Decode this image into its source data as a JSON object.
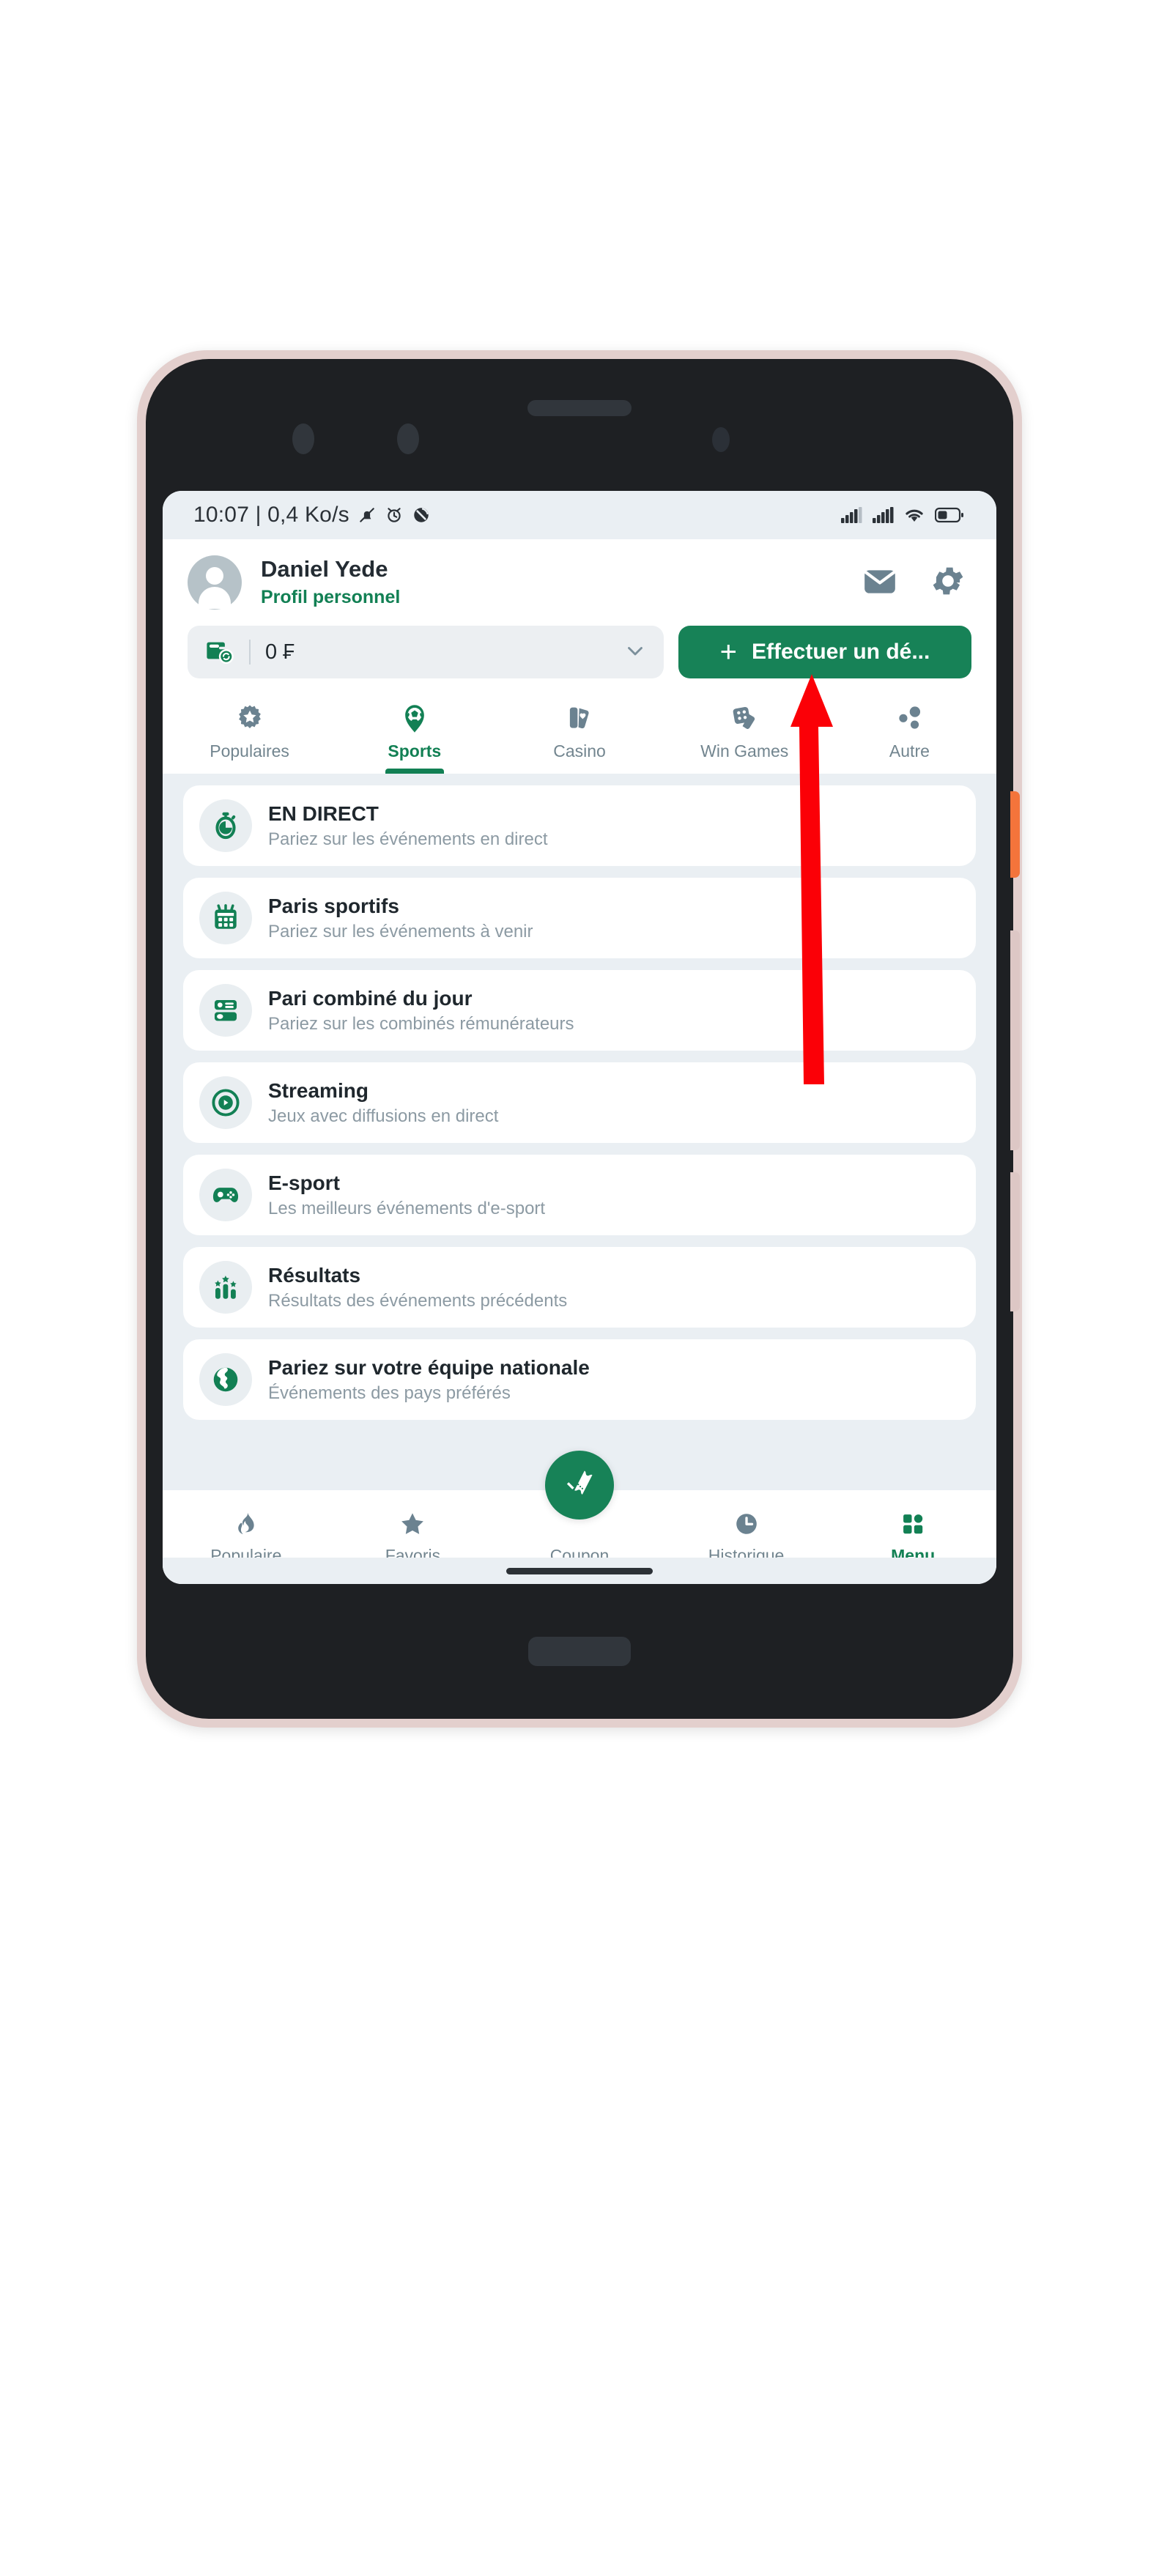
{
  "status_bar": {
    "clock_text": "10:07 | 0,4 Ko/s",
    "left_icons": [
      "mute-bell-icon",
      "alarm-icon",
      "dnd-icon"
    ],
    "right_icons": [
      "signal-1-icon",
      "signal-2-icon",
      "wifi-icon",
      "battery-icon"
    ],
    "battery_level_pct": 40
  },
  "header": {
    "profile_name": "Daniel Yede",
    "profile_subtitle": "Profil personnel",
    "avatar_icon": "person-avatar-icon",
    "mail_icon": "mail-icon",
    "settings_icon": "gear-icon"
  },
  "balance": {
    "wallet_icon": "wallet-refresh-icon",
    "value": "0 ₣",
    "chevron_icon": "chevron-down-icon",
    "deposit_label": "Effectuer un dé...",
    "deposit_plus": "+"
  },
  "category_tabs": [
    {
      "label": "Populaires",
      "icon": "star-burst-icon",
      "active": false
    },
    {
      "label": "Sports",
      "icon": "football-icon",
      "active": true
    },
    {
      "label": "Casino",
      "icon": "playing-cards-icon",
      "active": false
    },
    {
      "label": "Win Games",
      "icon": "dice-cards-icon",
      "active": false
    },
    {
      "label": "Autre",
      "icon": "dots-cluster-icon",
      "active": false
    }
  ],
  "menu_items": [
    {
      "title": "EN DIRECT",
      "subtitle": "Pariez sur les événements en direct",
      "icon": "stopwatch-icon"
    },
    {
      "title": "Paris sportifs",
      "subtitle": "Pariez sur les événements à venir",
      "icon": "calendar-icon"
    },
    {
      "title": "Pari combiné du jour",
      "subtitle": "Pariez sur les combinés rémunérateurs",
      "icon": "slip-list-icon"
    },
    {
      "title": "Streaming",
      "subtitle": "Jeux avec diffusions en direct",
      "icon": "play-circle-icon"
    },
    {
      "title": "E-sport",
      "subtitle": "Les meilleurs événements d'e-sport",
      "icon": "gamepad-icon"
    },
    {
      "title": "Résultats",
      "subtitle": "Résultats des événements précédents",
      "icon": "podium-stars-icon"
    },
    {
      "title": "Pariez sur votre équipe nationale",
      "subtitle": "Événements des pays préférés",
      "icon": "globe-icon"
    }
  ],
  "bottom_nav": [
    {
      "label": "Populaire",
      "icon": "flame-icon",
      "active": false
    },
    {
      "label": "Favoris",
      "icon": "star-icon",
      "active": false
    },
    {
      "label": "Coupon",
      "icon": "ticket-icon",
      "active": false
    },
    {
      "label": "Historique",
      "icon": "clock-icon",
      "active": false
    },
    {
      "label": "Menu",
      "icon": "grid-icon",
      "active": true
    }
  ],
  "annotation": {
    "arrow_icon": "red-arrow-up-icon",
    "arrow_color": "#fb0007",
    "points_to": "Effectuer un dé..."
  },
  "colors": {
    "brand_green": "#178257",
    "brand_green_text": "#128054",
    "app_background": "#eaeff3",
    "card_background": "#ffffff",
    "muted_text": "#8c9aa3",
    "icon_gray": "#6b8290",
    "phone_frame": "#e3cfcd",
    "phone_body": "#1e2023",
    "power_button": "#f4743b"
  }
}
